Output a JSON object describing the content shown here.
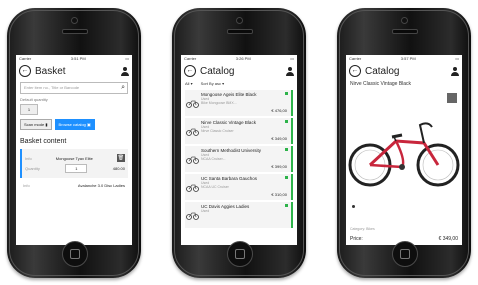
{
  "status": {
    "carrier": "Carrier",
    "time1": "3:51 PM",
    "time2": "3:26 PM",
    "time3": "3:57 PM"
  },
  "basket": {
    "title": "Basket",
    "search_placeholder": "Enter item no., Title or Barcode",
    "default_qty_label": "Default quantity",
    "default_qty_value": "1",
    "scan_label": "Scan mode",
    "browse_label": "Browse catalog",
    "section_title": "Basket content",
    "item1": {
      "sku": "Info",
      "name": "Mongoose Tyax Elite",
      "qty_label": "Quantity",
      "qty": "1",
      "price": "480.00"
    },
    "item2": {
      "sku": "Info",
      "name": "Avalanche 3.0 Disc Ladies",
      "price": ""
    }
  },
  "catalog": {
    "title": "Catalog",
    "filter_all": "All",
    "filter_sort": "Sort By asc",
    "items": [
      {
        "name": "Mongoose Ageis Elite Black",
        "sub": "Used",
        "sub2": "Bike Mongoose BMX...",
        "price": "€ 476,00"
      },
      {
        "name": "Nirve Classic Vintage Black",
        "sub": "Used",
        "sub2": "Nirve Classic Cruiser",
        "price": "€ 349,00"
      },
      {
        "name": "Southern Methodist University",
        "sub": "Used",
        "sub2": "NCAA Cruiser...",
        "price": "€ 399,00"
      },
      {
        "name": "UC Santa Barbara Gauchos",
        "sub": "Used",
        "sub2": "NCAA UC Cruiser",
        "price": "€ 310,00"
      },
      {
        "name": "UC Davis Aggies Ladies",
        "sub": "Used",
        "sub2": "",
        "price": ""
      }
    ]
  },
  "product": {
    "title": "Catalog",
    "name": "Nirve Classic Vintage Black",
    "meta": "Category: Bikes",
    "price_label": "Price:",
    "price_value": "€ 349,00"
  },
  "colors": {
    "accent": "#1e90ff",
    "stock": "#2db34a",
    "frame": "#222222"
  }
}
